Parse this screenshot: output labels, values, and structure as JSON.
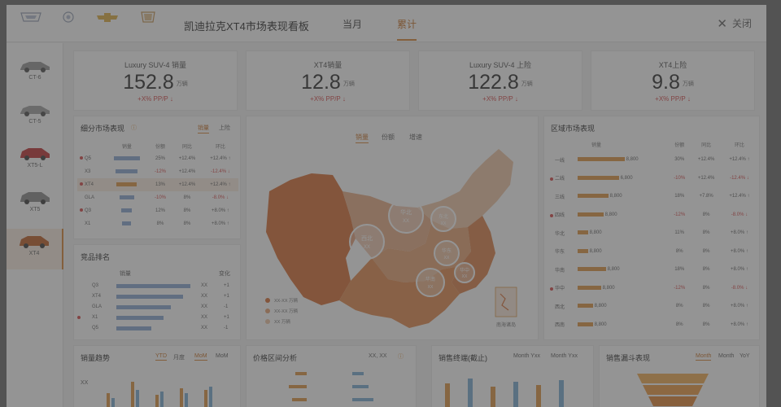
{
  "header": {
    "brands": [
      "",
      "",
      "",
      ""
    ],
    "title": "凯迪拉克XT4市场表现看板",
    "tabs": [
      "当月",
      "累计"
    ],
    "active_tab": "累计",
    "close_label": "关闭"
  },
  "nav": {
    "cars": [
      "CT-6",
      "CT-5",
      "XT5-L",
      "XT5",
      "XT4"
    ],
    "active": "XT4"
  },
  "kpis": [
    {
      "title": "Luxury SUV-4 销量",
      "value": "152.8",
      "unit": "万辆",
      "change": "+X% PP/P ↓"
    },
    {
      "title": "XT4销量",
      "value": "12.8",
      "unit": "万辆",
      "change": "+X% PP/P ↓"
    },
    {
      "title": "Luxury SUV-4 上险",
      "value": "122.8",
      "unit": "万辆",
      "change": "+X% PP/P ↓"
    },
    {
      "title": "XT4上险",
      "value": "9.8",
      "unit": "万辆",
      "change": "+X% PP/P ↓"
    }
  ],
  "segment": {
    "title": "细分市场表现",
    "toggles": [
      "销量",
      "上险"
    ],
    "headers": [
      "",
      "销量",
      "份额",
      "同比",
      "环比"
    ],
    "rows": [
      {
        "name": "Q5",
        "bar": 0.9,
        "share": "25%",
        "yoy": "+12.4%",
        "mom": "+12.4% ↑",
        "flag": true,
        "hl": false
      },
      {
        "name": "X3",
        "bar": 0.75,
        "share": "-12%",
        "yoy": "+12.4%",
        "mom": "-12.4% ↓",
        "flag": false,
        "hl": false
      },
      {
        "name": "XT4",
        "bar": 0.7,
        "share": "13%",
        "yoy": "+12.4%",
        "mom": "+12.4% ↑",
        "flag": true,
        "hl": true
      },
      {
        "name": "GLA",
        "bar": 0.5,
        "share": "-10%",
        "yoy": "8%",
        "mom": "-8.0% ↓",
        "flag": false,
        "hl": false
      },
      {
        "name": "Q3",
        "bar": 0.35,
        "share": "12%",
        "yoy": "8%",
        "mom": "+8.0% ↑",
        "flag": true,
        "hl": false
      },
      {
        "name": "X1",
        "bar": 0.3,
        "share": "8%",
        "yoy": "8%",
        "mom": "+8.0% ↑",
        "flag": false,
        "hl": false
      }
    ]
  },
  "rank": {
    "title": "竞品排名",
    "headers": [
      "销量",
      "变化"
    ],
    "rows": [
      {
        "name": "Q3",
        "value": 0.95,
        "v": "XX",
        "ch": "+1",
        "flag": false
      },
      {
        "name": "XT4",
        "value": 0.85,
        "v": "XX",
        "ch": "+1",
        "flag": false
      },
      {
        "name": "GLA",
        "value": 0.7,
        "v": "XX",
        "ch": "-1",
        "flag": false
      },
      {
        "name": "X1",
        "value": 0.6,
        "v": "XX",
        "ch": "+1",
        "flag": true
      },
      {
        "name": "Q5",
        "value": 0.45,
        "v": "XX",
        "ch": "-1",
        "flag": false
      }
    ]
  },
  "map": {
    "tabs": [
      "销量",
      "份额",
      "增速"
    ],
    "active_tab": "销量",
    "bubbles": [
      {
        "name": "华北",
        "value": "XX"
      },
      {
        "name": "东北",
        "value": "XX"
      },
      {
        "name": "西北",
        "value": "XX"
      },
      {
        "name": "华东",
        "value": "XX"
      },
      {
        "name": "华中",
        "value": "XX"
      },
      {
        "name": "华南",
        "value": "XX"
      }
    ],
    "legend": [
      "XX-XX 万辆",
      "XX-XX 万辆",
      "XX 万辆"
    ],
    "inset_label": "南海诸岛"
  },
  "region": {
    "title": "区域市场表现",
    "headers": [
      "销量",
      "份额",
      "同比",
      "环比"
    ],
    "rows": [
      {
        "name": "一线",
        "bar": 0.9,
        "val": "8,800",
        "share": "30%",
        "yoy": "+12.4%",
        "mom": "+12.4% ↑",
        "neg": false,
        "flag": false
      },
      {
        "name": "二线",
        "bar": 0.8,
        "val": "6,800",
        "share": "-10%",
        "yoy": "+12.4%",
        "mom": "-12.4% ↓",
        "neg": true,
        "flag": true
      },
      {
        "name": "三线",
        "bar": 0.6,
        "val": "8,800",
        "share": "18%",
        "yoy": "+7.8%",
        "mom": "+12.4% ↑",
        "neg": false,
        "flag": false
      },
      {
        "name": "四线",
        "bar": 0.5,
        "val": "8,800",
        "share": "-12%",
        "yoy": "8%",
        "mom": "-8.0% ↓",
        "neg": true,
        "flag": true
      },
      {
        "name": "华北",
        "bar": 0.2,
        "val": "8,800",
        "share": "11%",
        "yoy": "8%",
        "mom": "+8.0% ↑",
        "neg": false,
        "flag": false
      },
      {
        "name": "华东",
        "bar": 0.2,
        "val": "8,800",
        "share": "8%",
        "yoy": "8%",
        "mom": "+8.0% ↑",
        "neg": false,
        "flag": false
      },
      {
        "name": "华南",
        "bar": 0.55,
        "val": "8,800",
        "share": "18%",
        "yoy": "8%",
        "mom": "+8.0% ↑",
        "neg": false,
        "flag": false
      },
      {
        "name": "华中",
        "bar": 0.45,
        "val": "8,800",
        "share": "-12%",
        "yoy": "8%",
        "mom": "-8.0% ↓",
        "neg": true,
        "flag": true
      },
      {
        "name": "西北",
        "bar": 0.3,
        "val": "8,800",
        "share": "8%",
        "yoy": "8%",
        "mom": "+8.0% ↑",
        "neg": false,
        "flag": false
      },
      {
        "name": "西南",
        "bar": 0.3,
        "val": "8,800",
        "share": "8%",
        "yoy": "8%",
        "mom": "+8.0% ↑",
        "neg": false,
        "flag": false
      }
    ]
  },
  "bottom": {
    "trend": {
      "title": "销量趋势",
      "toggles": [
        "YTD",
        "月度",
        "MoM",
        "MoM"
      ],
      "y_label": "XX"
    },
    "price": {
      "title": "价格区间分析",
      "unit": "XX, XX"
    },
    "trade": {
      "title": "销售终端(截止)",
      "legend": [
        "Month Yxx",
        "Month Yxx"
      ]
    },
    "funnel": {
      "title": "销售漏斗表现",
      "toggles": [
        "Month",
        "Month",
        "YoY"
      ]
    }
  },
  "colors": {
    "accent": "#d98a3c",
    "negative": "#d74f4f",
    "blue": "#8eaad6"
  }
}
